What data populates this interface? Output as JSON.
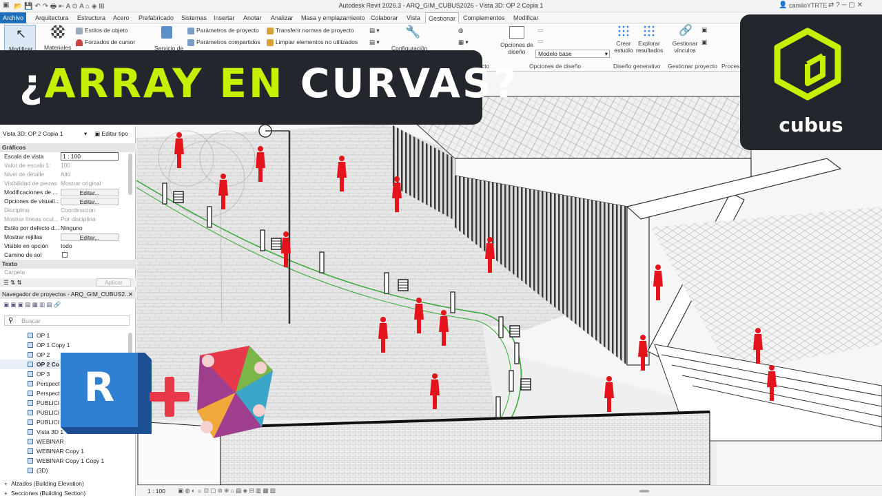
{
  "app": {
    "title": "Autodesk Revit 2026.3 - ARQ_GIM_CUBUS2026 - Vista 3D: OP 2 Copia 1",
    "user": "camiloYTRTE"
  },
  "menu": {
    "tabs": [
      "Archivo",
      "Arquitectura",
      "Estructura",
      "Acero",
      "Prefabricado",
      "Sistemas",
      "Insertar",
      "Anotar",
      "Analizar",
      "Masa y emplazamiento",
      "Colaborar",
      "Vista",
      "Gestionar",
      "Complementos",
      "Modificar"
    ],
    "active": "Gestionar"
  },
  "ribbon": {
    "modify": "Modificar",
    "materials": "Materiales",
    "object_styles": "Estilos de objeto",
    "snaps": "Forzados de cursor",
    "project_location": "Servicio de",
    "project_params": "Parámetros de proyecto",
    "shared_params": "Parámetros compartidos",
    "transfer": "Transferir normas de proyecto",
    "purge": "Limpiar elementos no utilizados",
    "config": "Configuración",
    "design_options": "Opciones de diseño",
    "design_options_btn_l1": "Opciones de",
    "design_options_btn_l2": "diseño",
    "main_model": "Modelo base",
    "panel_project": "yecto",
    "panel_design_options": "Opciones de diseño",
    "create_study_l1": "Crear",
    "create_study_l2": "estudio",
    "explore_l1": "Explorar",
    "explore_l2": "resultados",
    "panel_generative": "Diseño generativo",
    "manage_links_l1": "Gestionar",
    "manage_links_l2": "vínculos",
    "panel_manage_project": "Gestionar proyecto",
    "panel_process": "Proceso"
  },
  "banner": {
    "q_open": "¿",
    "w1": "ARRAY",
    "w2": "EN",
    "w3": "CURVAS?"
  },
  "brand": {
    "name": "cubus",
    "accent": "#c6f000"
  },
  "properties": {
    "type_selector": "Vista 3D: OP 2 Copia 1",
    "edit_type": "Editar tipo",
    "section_graphics": "Gráficos",
    "rows": [
      {
        "k": "Escala de vista",
        "v": "1 : 100",
        "dim": false
      },
      {
        "k": "Valor de escala   1:",
        "v": "100",
        "dim": true
      },
      {
        "k": "Nivel de detalle",
        "v": "Alto",
        "dim": true
      },
      {
        "k": "Visibilidad de piezas",
        "v": "Mostrar original",
        "dim": true
      },
      {
        "k": "Modificaciones de ...",
        "v": "Editar...",
        "dim": false,
        "btn": true
      },
      {
        "k": "Opciones de visuali...",
        "v": "Editar...",
        "dim": false,
        "btn": true
      },
      {
        "k": "Disciplina",
        "v": "Coordinación",
        "dim": true
      },
      {
        "k": "Mostrar líneas ocul...",
        "v": "Por disciplina",
        "dim": true
      },
      {
        "k": "Estilo por defecto d...",
        "v": "Ninguno",
        "dim": false
      },
      {
        "k": "Mostrar rejillas",
        "v": "Editar...",
        "dim": false,
        "btn": true
      },
      {
        "k": "Visible en opción",
        "v": "todo",
        "dim": false
      },
      {
        "k": "Camino de sol",
        "v": "",
        "dim": false
      }
    ],
    "section_text": "Texto",
    "folder": "Carpeta",
    "apply": "Aplicar"
  },
  "browser": {
    "title": "Navegador de proyectos - ARQ_GIM_CUBUS2...",
    "search_placeholder": "Buscar",
    "items": [
      "OP 1",
      "OP 1 Copy 1",
      "OP 2",
      "OP 2 Co",
      "OP 3",
      "Perspect",
      "Perspect",
      "PUBLICI",
      "PUBLICI",
      "PUBLICI",
      "Vista 3D 1",
      "WEBINAR",
      "WEBINAR Copy 1",
      "WEBINAR Copy 1 Copy 1",
      "(3D)"
    ],
    "elevations": "Alzados (Building Elevation)",
    "sections": "Secciones (Building Section)"
  },
  "statusbar": {
    "scale": "1 : 100"
  },
  "logos": {
    "revit_letter": "R"
  }
}
